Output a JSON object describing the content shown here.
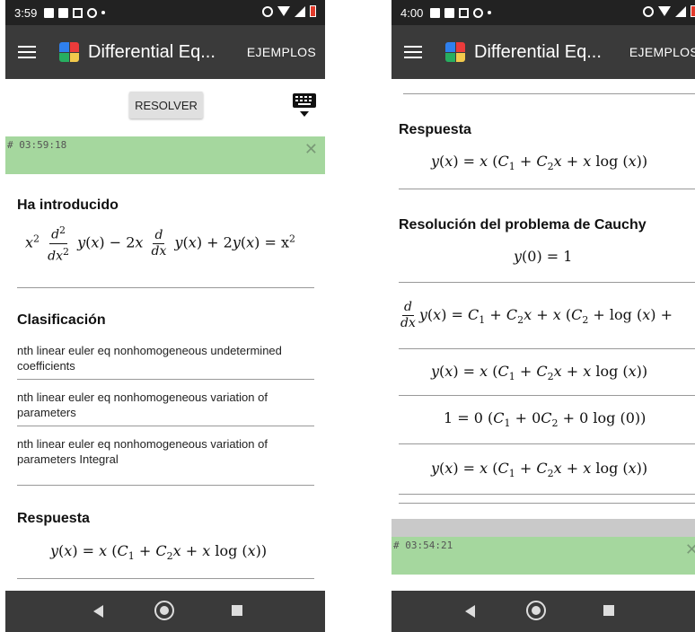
{
  "phone1": {
    "status": {
      "time": "3:59"
    },
    "appbar": {
      "title": "Differential Eq...",
      "action": "EJEMPLOS"
    },
    "toolbar": {
      "resolver_label": "RESOLVER"
    },
    "result": {
      "timestamp": "# 03:59:18",
      "introduced_heading": "Ha introducido",
      "equation_rhs": "= x",
      "classification_heading": "Clasificación",
      "classifications": [
        "nth linear euler eq nonhomogeneous undetermined coefficients",
        "nth linear euler eq nonhomogeneous variation of parameters",
        "nth linear euler eq nonhomogeneous variation of parameters Integral"
      ],
      "answer_heading": "Respuesta"
    }
  },
  "phone2": {
    "status": {
      "time": "4:00"
    },
    "appbar": {
      "title": "Differential Eq...",
      "action": "EJEMPLOS"
    },
    "result": {
      "answer_heading": "Respuesta",
      "cauchy_heading": "Resolución del problema de Cauchy",
      "cauchy_condition": "y(0) = 1",
      "timestamp2": "# 03:54:21"
    }
  },
  "colors": {
    "appbar": "#3a3a3a",
    "statusbar": "#222222",
    "result_banner": "#a5d79e",
    "navbar": "#3a3a3a"
  },
  "icons": [
    "menu-icon",
    "app-logo-icon",
    "keyboard-icon",
    "close-icon",
    "back-icon",
    "home-icon",
    "recents-icon"
  ]
}
